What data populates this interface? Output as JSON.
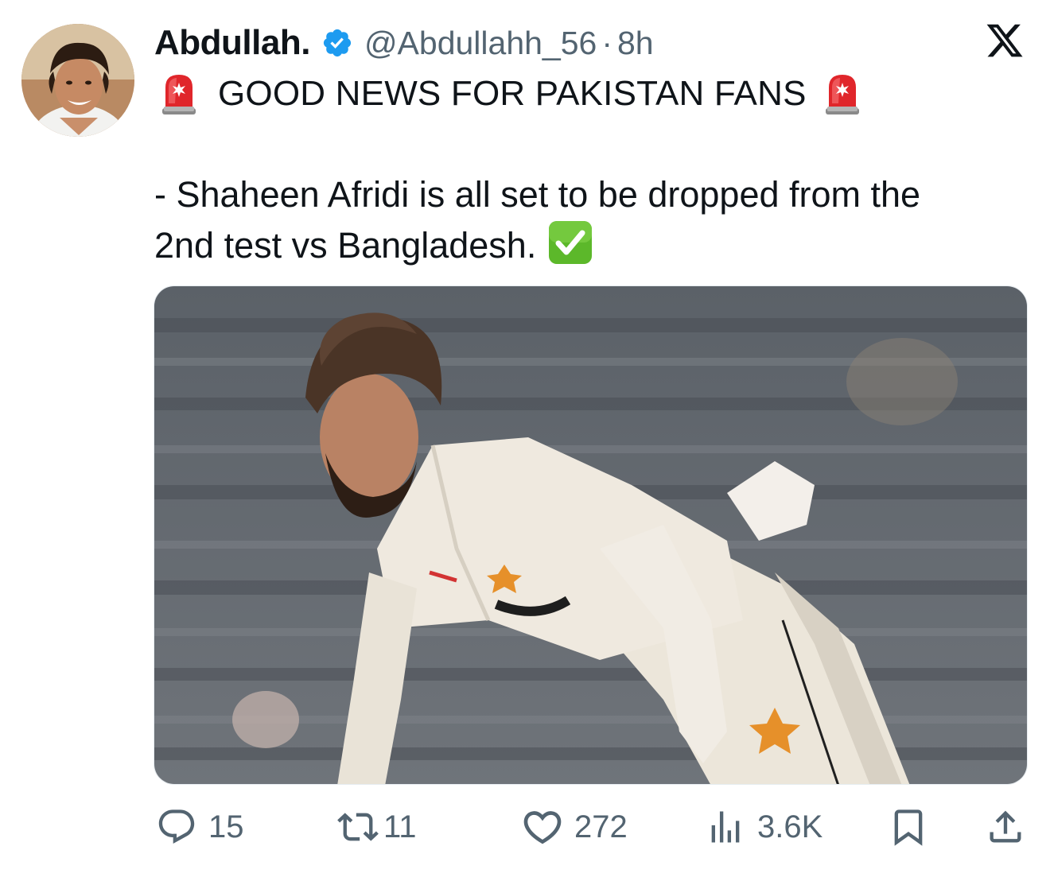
{
  "tweet": {
    "author_name": "Abdullah.",
    "handle": "@Abdullahh_56",
    "separator": "·",
    "time": "8h",
    "headline": "GOOD NEWS FOR PAKISTAN FANS",
    "body_line1": "- Shaheen Afridi is all set to be dropped from the",
    "body_line2": "2nd test vs Bangladesh."
  },
  "actions": {
    "replies": "15",
    "reposts": "11",
    "likes": "272",
    "views": "3.6K"
  },
  "icons": {
    "verified": "verified-badge-icon",
    "siren": "police-siren-emoji",
    "check": "check-mark-button-emoji",
    "x_logo": "x-logo-icon",
    "reply": "reply-icon",
    "repost": "repost-icon",
    "like": "heart-icon",
    "views": "views-chart-icon",
    "bookmark": "bookmark-icon",
    "share": "share-icon"
  },
  "colors": {
    "text": "#0f1419",
    "secondary": "#536471",
    "verified_blue": "#1d9bf0"
  }
}
